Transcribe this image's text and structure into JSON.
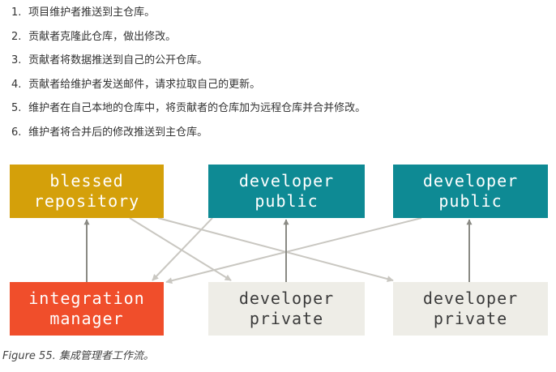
{
  "steps": [
    {
      "num": "1.",
      "text": "项目维护者推送到主仓库。"
    },
    {
      "num": "2.",
      "text": "贡献者克隆此仓库，做出修改。"
    },
    {
      "num": "3.",
      "text": "贡献者将数据推送到自己的公开仓库。"
    },
    {
      "num": "4.",
      "text": "贡献者给维护者发送邮件，请求拉取自己的更新。"
    },
    {
      "num": "5.",
      "text": "维护者在自己本地的仓库中，将贡献者的仓库加为远程仓库并合并修改。"
    },
    {
      "num": "6.",
      "text": "维护者将合并后的修改推送到主仓库。"
    }
  ],
  "boxes": {
    "blessed": {
      "line1": "blessed",
      "line2": "repository",
      "color": "#d4a00a"
    },
    "public1": {
      "line1": "developer",
      "line2": "public",
      "color": "#0e8a94"
    },
    "public2": {
      "line1": "developer",
      "line2": "public",
      "color": "#0e8a94"
    },
    "integration": {
      "line1": "integration",
      "line2": "manager",
      "color": "#f04e2b"
    },
    "private1": {
      "line1": "developer",
      "line2": "private",
      "color": "#eeede7"
    },
    "private2": {
      "line1": "developer",
      "line2": "private",
      "color": "#eeede7"
    }
  },
  "caption": "Figure 55. 集成管理者工作流。"
}
